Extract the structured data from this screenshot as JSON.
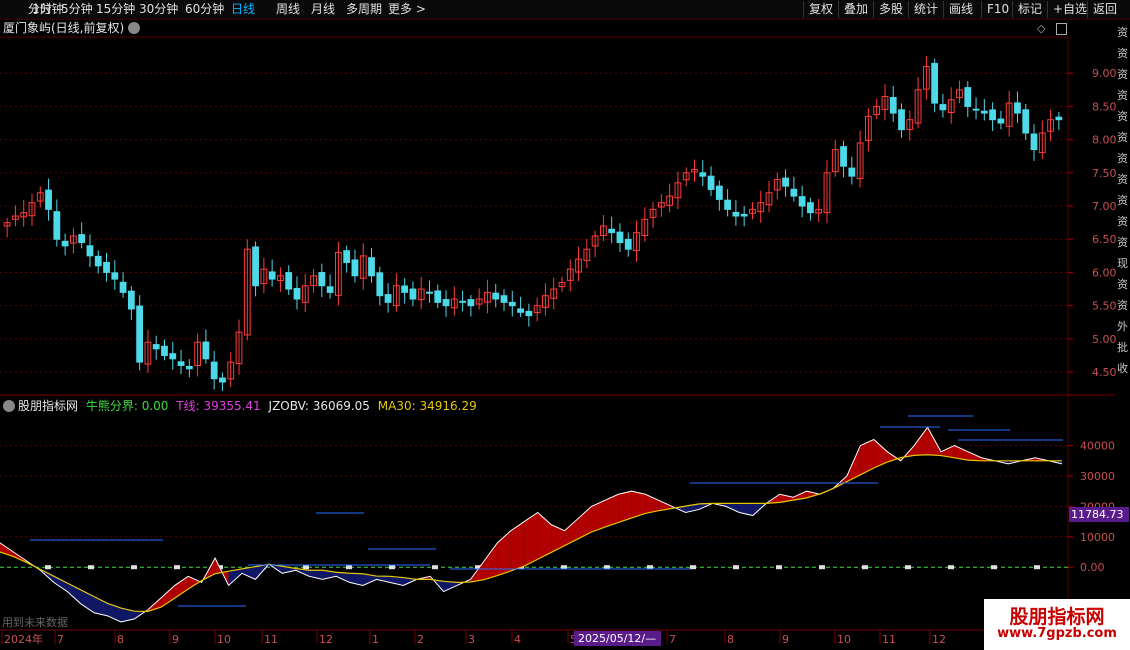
{
  "toolbar": {
    "timeframes": [
      "分时",
      "1分钟",
      "5分钟",
      "15分钟",
      "30分钟",
      "60分钟",
      "日线",
      "周线",
      "月线",
      "多周期",
      "更多"
    ],
    "active": "日线",
    "buttons": [
      "复权",
      "叠加",
      "多股",
      "统计",
      "画线",
      "F10",
      "标记",
      "+自选",
      "返回"
    ]
  },
  "main_chart": {
    "title": "厦门象屿(日线,前复权)",
    "y_ticks": [
      "9.00",
      "8.50",
      "8.00",
      "7.50",
      "7.00",
      "6.50",
      "6.00",
      "5.50",
      "5.00",
      "4.50"
    ],
    "up_color": "#ff3c3c",
    "down_color": "#4dd9e8"
  },
  "indicator": {
    "name": "股朋指标网",
    "label1": "牛熊分界: 0.00",
    "label2": "T线: 39355.41",
    "label3": "JZOBV: 36069.05",
    "label4": "MA30: 34916.29",
    "y_ticks": [
      "40000",
      "30000",
      "20000",
      "10000",
      "0.00"
    ],
    "current_value": "11784.73",
    "note": "用到未来数据"
  },
  "x_axis": {
    "labels": [
      "2024年",
      "7",
      "8",
      "9",
      "10",
      "11",
      "12",
      "1",
      "2",
      "3",
      "4",
      "5",
      "7",
      "8",
      "9",
      "10",
      "11",
      "12"
    ],
    "cursor_date": "2025/05/12/—"
  },
  "watermark": {
    "title": "股朋指标网",
    "url": "www.7gpzb.com"
  },
  "chart_data": [
    {
      "type": "line",
      "title": "厦门象屿(日线,前复权)",
      "note": "daily candlestick close prices (approximate), 2024 Jun - 2026 Jan",
      "ylim": [
        4.2,
        9.5
      ],
      "series": [
        {
          "values": [
            6.75,
            6.85,
            6.9,
            7.05,
            7.2,
            6.95,
            6.5,
            6.4,
            6.55,
            6.45,
            6.25,
            6.1,
            6.0,
            5.9,
            5.7,
            5.45,
            4.65,
            4.95,
            4.85,
            4.75,
            4.7,
            4.6,
            4.55,
            4.95,
            4.7,
            4.4,
            4.35,
            4.65,
            5.1,
            6.35,
            5.8,
            6.05,
            5.9,
            5.95,
            5.75,
            5.6,
            5.8,
            5.95,
            5.8,
            5.7,
            6.3,
            6.15,
            5.95,
            6.25,
            5.95,
            5.65,
            5.55,
            5.8,
            5.7,
            5.6,
            5.75,
            5.7,
            5.55,
            5.5,
            5.6,
            5.55,
            5.5,
            5.6,
            5.7,
            5.6,
            5.55,
            5.5,
            5.4,
            5.35,
            5.5,
            5.65,
            5.75,
            5.85,
            6.05,
            6.2,
            6.35,
            6.55,
            6.7,
            6.6,
            6.45,
            6.35,
            6.6,
            6.8,
            6.95,
            7.05,
            7.15,
            7.35,
            7.5,
            7.55,
            7.45,
            7.25,
            7.1,
            6.95,
            6.85,
            6.85,
            6.95,
            7.05,
            7.2,
            7.4,
            7.3,
            7.15,
            7.0,
            6.9,
            6.95,
            7.5,
            7.85,
            7.6,
            7.45,
            7.95,
            8.35,
            8.5,
            8.65,
            8.4,
            8.15,
            8.3,
            8.75,
            9.1,
            8.55,
            8.45,
            8.6,
            8.75,
            8.5,
            8.45,
            8.4,
            8.3,
            8.25,
            8.55,
            8.4,
            8.1,
            7.85,
            8.1,
            8.3,
            8.3
          ]
        }
      ]
    },
    {
      "type": "area",
      "title": "股朋指标网",
      "ylim": [
        -20000,
        55000
      ],
      "series": [
        {
          "name": "JZOBV",
          "values": [
            8000,
            5000,
            2000,
            -1000,
            -5000,
            -8000,
            -12000,
            -15000,
            -16000,
            -18000,
            -17000,
            -14000,
            -10000,
            -6000,
            -3000,
            -5000,
            3000,
            -6000,
            -2000,
            -4000,
            1000,
            -2000,
            -1000,
            -3000,
            -4000,
            -3000,
            -5000,
            -6000,
            -4000,
            -5000,
            -6000,
            -4000,
            -3000,
            -8000,
            -6000,
            -4000,
            2000,
            8000,
            12000,
            15000,
            18000,
            14000,
            12000,
            16000,
            20000,
            22000,
            24000,
            25000,
            24000,
            22000,
            20000,
            18000,
            19000,
            21000,
            20000,
            18000,
            17000,
            21000,
            24000,
            23000,
            25000,
            24000,
            26000,
            30000,
            40000,
            42000,
            38000,
            35000,
            40000,
            46000,
            38000,
            40000,
            38000,
            36000,
            35000,
            34000,
            35000,
            36000,
            35000,
            34000
          ]
        },
        {
          "name": "MA30",
          "values": [
            5000,
            3000,
            0,
            -3000,
            -6000,
            -9000,
            -12000,
            -14000,
            -15000,
            -13000,
            -9000,
            -5000,
            -2000,
            -1000,
            0,
            1000,
            0,
            -1000,
            -1000,
            -2000,
            -2000,
            -3000,
            -3000,
            -4000,
            -4000,
            -5000,
            -5000,
            -4000,
            -2000,
            0,
            3000,
            6000,
            9000,
            12000,
            14000,
            16000,
            18000,
            19000,
            20000,
            21000,
            21000,
            21000,
            21000,
            21000,
            22000,
            23000,
            25000,
            28000,
            31000,
            34000,
            36000,
            37000,
            37000,
            36000,
            35000,
            35000,
            35000,
            35000,
            35000,
            35000
          ]
        }
      ]
    }
  ]
}
